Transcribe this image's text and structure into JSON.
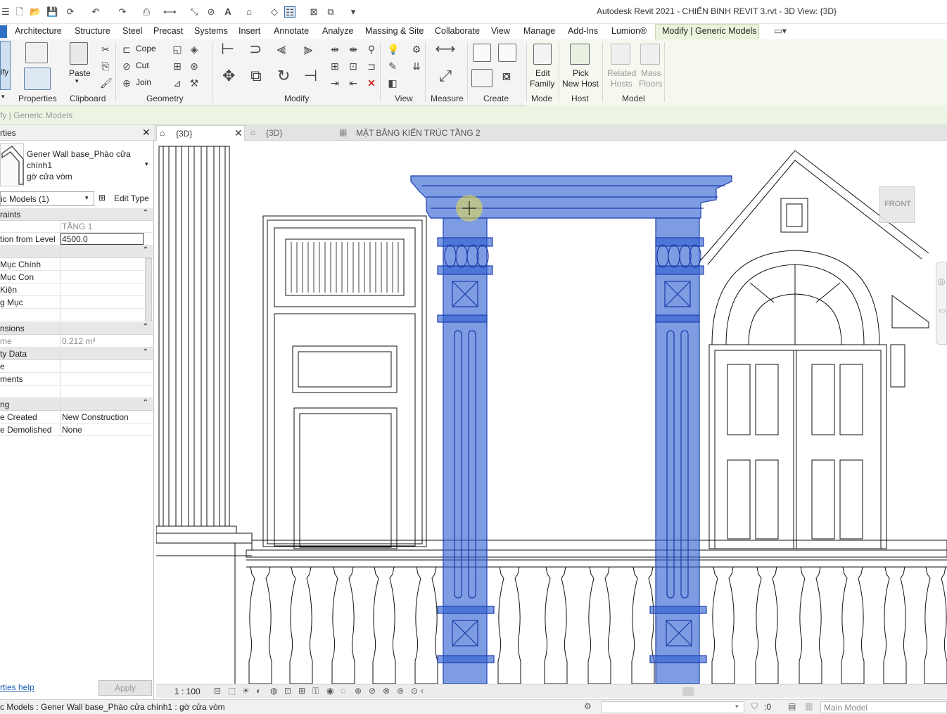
{
  "app": {
    "window_title": "Autodesk Revit 2021 - CHIẾN BINH REVIT 3.rvt - 3D View: {3D}"
  },
  "ribbon_tabs": [
    "Architecture",
    "Structure",
    "Steel",
    "Precast",
    "Systems",
    "Insert",
    "Annotate",
    "Analyze",
    "Massing & Site",
    "Collaborate",
    "View",
    "Manage",
    "Add-Ins",
    "Lumion®",
    "Modify | Generic Models"
  ],
  "ribbon": {
    "modify_label": "ify",
    "paste": "Paste",
    "cope": "Cope",
    "cut": "Cut",
    "join": "Join",
    "edit_family": [
      "Edit",
      "Family"
    ],
    "pick_new_host": [
      "Pick",
      "New Host"
    ],
    "related_hosts": [
      "Related",
      "Hosts"
    ],
    "mass_floors": [
      "Mass",
      "Floors"
    ],
    "panels": {
      "properties": "Properties",
      "clipboard": "Clipboard",
      "geometry": "Geometry",
      "modify": "Modify",
      "view": "View",
      "measure": "Measure",
      "create": "Create",
      "mode": "Mode",
      "host": "Host",
      "model": "Model"
    }
  },
  "options_bar": {
    "text": "fy | Generic Models"
  },
  "properties": {
    "header": "rties",
    "type_name": [
      "Gener Wall base_Phào cửa",
      "chính1",
      "gờ cửa vòm"
    ],
    "selector": "ic Models (1)",
    "edit_type": "Edit Type",
    "sections": {
      "constraints": "raints",
      "unnamed": "",
      "dimensions": "nsions",
      "identity": "ty Data",
      "phasing": "ng"
    },
    "rows": {
      "level_value": "TẦNG 1",
      "elevation_name": "tion from Level",
      "elevation_value": "4500.0",
      "muc_chinh": "Mục Chính",
      "muc_con": "Mục Con",
      "kien": "Kiện",
      "g_muc": "g Mục",
      "volume_name": "me",
      "volume_value": "0.212 m³",
      "image_name": "e",
      "comments_name": "ments",
      "phase_created_name": "e Created",
      "phase_created_value": "New Construction",
      "phase_demolished_name": "e Demolished",
      "phase_demolished_value": "None"
    },
    "help_link": "rties help",
    "apply": "Apply"
  },
  "view_tabs": [
    {
      "label": "{3D}",
      "active": true
    },
    {
      "label": "{3D}",
      "active": false
    },
    {
      "label": "MẶT BẰNG KIẾN TRÚC TẦNG 2",
      "active": false
    }
  ],
  "viewcube": {
    "face": "FRONT"
  },
  "view_control": {
    "scale": "1 : 100"
  },
  "status_bar": {
    "selection": "c Models : Gener Wall base_Phào cửa chính1 : gờ cửa vòm",
    "filter_count": ":0",
    "workset": "Main Model"
  },
  "colors": {
    "selection_fill": "#2f5fd0",
    "context_tab_bg": "#eaf3dc",
    "cursor_highlight": "#e8e04a"
  }
}
